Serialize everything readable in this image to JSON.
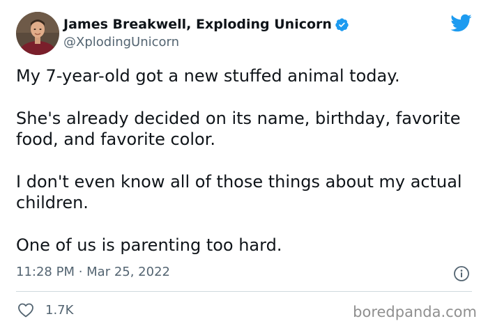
{
  "author": {
    "display_name": "James Breakwell, Exploding Unicorn",
    "handle": "@XplodingUnicorn",
    "verified": true
  },
  "tweet": {
    "paragraphs": [
      "My 7-year-old got a new stuffed animal today.",
      "She's already decided on its name, birthday, favorite food, and favorite color.",
      "I don't even know all of those things about my actual children.",
      "One of us is parenting too hard."
    ],
    "timestamp": "11:28 PM · Mar 25, 2022",
    "likes": "1.7K"
  },
  "icons": {
    "brand": "twitter-bird-icon",
    "verified": "verified-badge-icon",
    "info": "info-icon",
    "like": "heart-icon"
  },
  "colors": {
    "twitter_blue": "#1d9bf0",
    "text_primary": "#0f1419",
    "text_secondary": "#536471",
    "divider": "#cfd9de",
    "watermark": "#8f8f8f"
  },
  "watermark": "boredpanda.com"
}
